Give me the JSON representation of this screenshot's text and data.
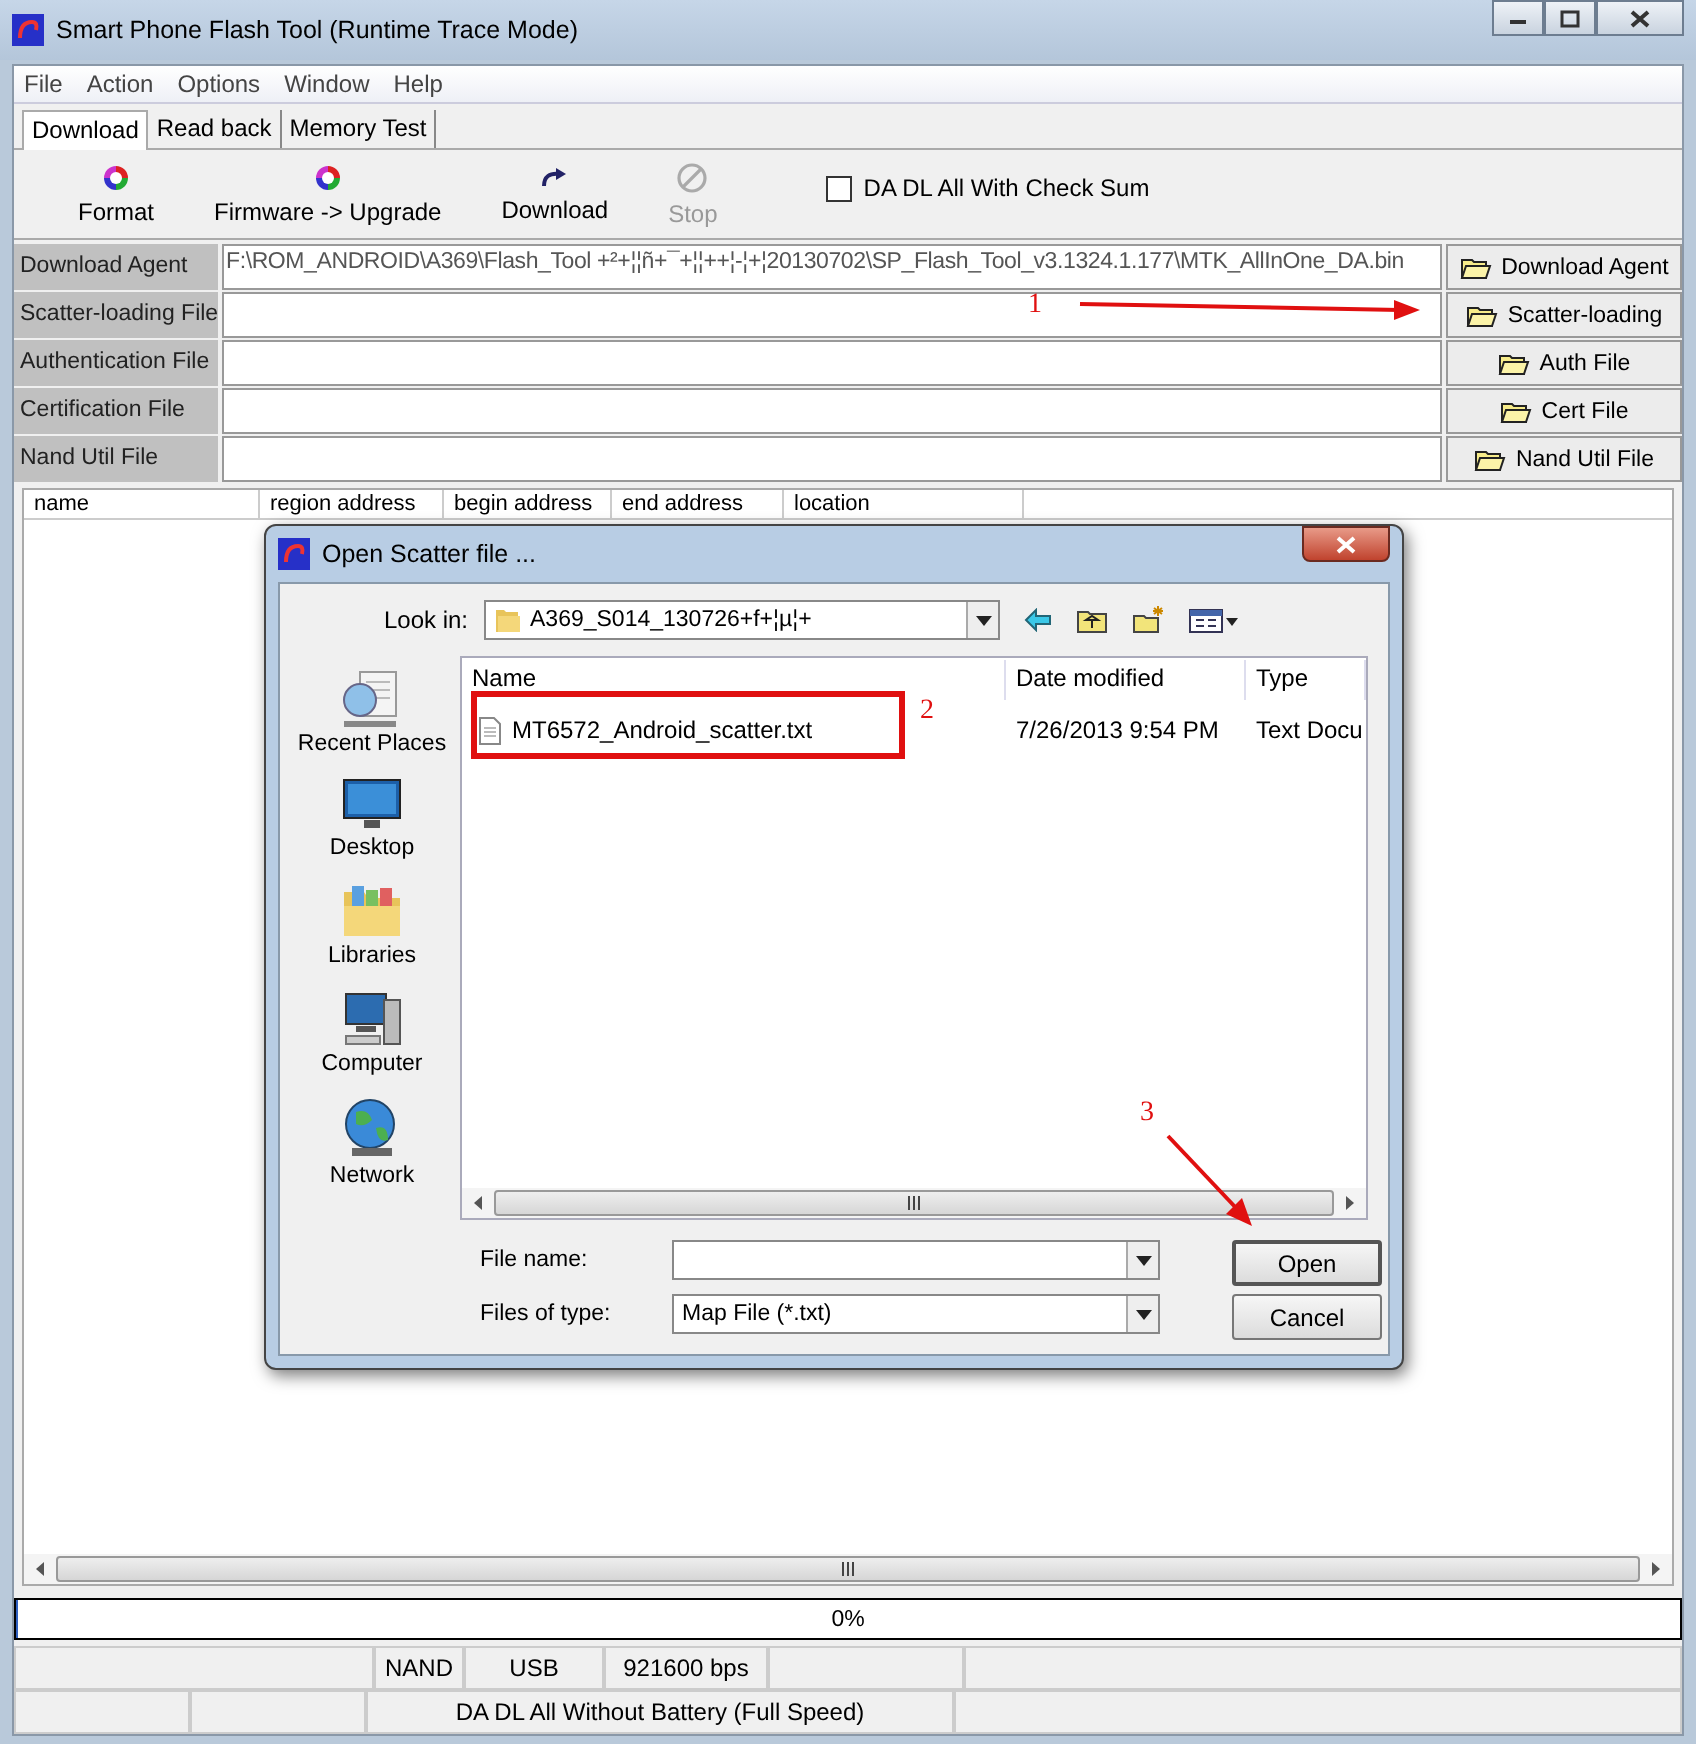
{
  "window": {
    "title": "Smart Phone Flash Tool (Runtime Trace Mode)"
  },
  "menu": [
    "File",
    "Action",
    "Options",
    "Window",
    "Help"
  ],
  "tabs": [
    {
      "label": "Download",
      "selected": true
    },
    {
      "label": "Read back",
      "selected": false
    },
    {
      "label": "Memory Test",
      "selected": false
    }
  ],
  "toolbar": {
    "buttons": [
      {
        "label": "Format",
        "kind": "format",
        "disabled": false
      },
      {
        "label": "Firmware -> Upgrade",
        "kind": "format",
        "disabled": false
      },
      {
        "label": "Download",
        "kind": "download",
        "disabled": false
      },
      {
        "label": "Stop",
        "kind": "stop",
        "disabled": true
      }
    ],
    "checkbox": {
      "label": "DA DL All With Check Sum",
      "checked": false
    }
  },
  "files": [
    {
      "label": "Download Agent",
      "value": "F:\\ROM_ANDROID\\A369\\Flash_Tool +²+¦¦ñ+¯+¦¦++¦-¦+¦20130702\\SP_Flash_Tool_v3.1324.1.177\\MTK_AllInOne_DA.bin",
      "button": "Download Agent"
    },
    {
      "label": "Scatter-loading File",
      "button": "Scatter-loading"
    },
    {
      "label": "Authentication File",
      "button": "Auth File"
    },
    {
      "label": "Certification File",
      "button": "Cert File"
    },
    {
      "label": "Nand Util File",
      "button": "Nand Util File"
    }
  ],
  "list_columns": [
    "name",
    "region address",
    "begin address",
    "end address",
    "location"
  ],
  "progress": {
    "text": "0%",
    "level": 0
  },
  "status": [
    "NAND",
    "USB",
    "921600 bps"
  ],
  "status_mode": "DA DL All Without Battery (Full Speed)",
  "dialog": {
    "title": "Open Scatter file ...",
    "look_in_label": "Look in:",
    "look_in": "A369_S014_130726+f+¦µ¦+",
    "places": [
      {
        "label": "Recent Places",
        "kind": "recent"
      },
      {
        "label": "Desktop",
        "kind": "desktop"
      },
      {
        "label": "Libraries",
        "kind": "libraries"
      },
      {
        "label": "Computer",
        "kind": "computer"
      },
      {
        "label": "Network",
        "kind": "network"
      }
    ],
    "columns": [
      "Name",
      "Date modified",
      "Type"
    ],
    "files": [
      {
        "name": "MT6572_Android_scatter.txt",
        "date": "7/26/2013 9:54 PM",
        "type": "Text Docu"
      }
    ],
    "file_name_label": "File name:",
    "file_type_label": "Files of type:",
    "file_type": "Map File (*.txt)",
    "buttons": [
      "Open",
      "Cancel"
    ]
  },
  "annotations": [
    {
      "text": "1"
    },
    {
      "text": "2"
    },
    {
      "text": "3"
    }
  ]
}
